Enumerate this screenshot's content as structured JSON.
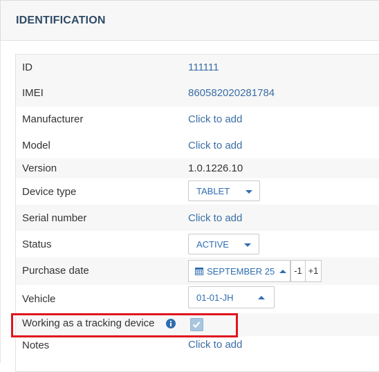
{
  "section": {
    "title": "IDENTIFICATION"
  },
  "fields": {
    "id": {
      "label": "ID",
      "value": "111111"
    },
    "imei": {
      "label": "IMEI",
      "value": "860582020281784"
    },
    "manufacturer": {
      "label": "Manufacturer",
      "value": "Click to add"
    },
    "model": {
      "label": "Model",
      "value": "Click to add"
    },
    "version": {
      "label": "Version",
      "value": "1.0.1226.10"
    },
    "device_type": {
      "label": "Device type",
      "value": "TABLET"
    },
    "serial_number": {
      "label": "Serial number",
      "value": "Click to add"
    },
    "status": {
      "label": "Status",
      "value": "ACTIVE"
    },
    "purchase_date": {
      "label": "Purchase date",
      "value": "SEPTEMBER 25",
      "minus": "-1",
      "plus": "+1"
    },
    "vehicle": {
      "label": "Vehicle",
      "value": "01-01-JH"
    },
    "tracking": {
      "label": "Working as a tracking device",
      "checked": true
    },
    "notes": {
      "label": "Notes",
      "value": "Click to add"
    }
  },
  "icons": {
    "info": "info-circle-icon",
    "calendar": "calendar-icon",
    "checkbox": "check-icon"
  },
  "colors": {
    "link": "#3a6ea5",
    "header_text": "#2f4b66",
    "highlight": "#e0141e"
  }
}
